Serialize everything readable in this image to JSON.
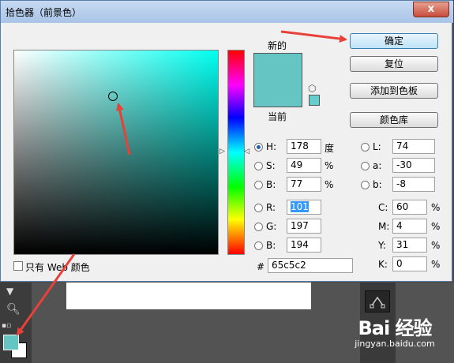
{
  "dialog": {
    "title": "拾色器（前景色）",
    "close_glyph": "x",
    "label_new": "新的",
    "label_current": "当前",
    "new_color": "#65c5c2",
    "websafe_color": "#66cccc"
  },
  "buttons": {
    "ok": "确定",
    "reset": "复位",
    "add_to_swatches": "添加到色板",
    "color_libraries": "颜色库"
  },
  "hsb": {
    "h_label": "H:",
    "h_value": "178",
    "h_unit": "度",
    "s_label": "S:",
    "s_value": "49",
    "s_unit": "%",
    "b_label": "B:",
    "b_value": "77",
    "b_unit": "%"
  },
  "rgb": {
    "r_label": "R:",
    "r_value": "101",
    "g_label": "G:",
    "g_value": "197",
    "b_label": "B:",
    "b_value": "194"
  },
  "lab": {
    "l_label": "L:",
    "l_value": "74",
    "a_label": "a:",
    "a_value": "-30",
    "b_label": "b:",
    "b_value": "-8"
  },
  "cmyk": {
    "c_label": "C:",
    "c_value": "60",
    "m_label": "M:",
    "m_value": "4",
    "y_label": "Y:",
    "y_value": "31",
    "k_label": "K:",
    "k_value": "0",
    "unit": "%"
  },
  "hex": {
    "label": "#",
    "value": "65c5c2"
  },
  "websafe": {
    "label": "只有 Web 颜色"
  },
  "watermark": {
    "logo": "Bai 经验",
    "sub": "jingyan.baidu.com"
  },
  "colors": {
    "annotation_arrow": "#e8413a",
    "title_bar": "#b5cdeb",
    "foreground": "#65c5c2"
  },
  "icons": [
    "close-icon",
    "cube-icon",
    "magnifier-icon",
    "tool-triangle-icon",
    "swap-icon"
  ]
}
